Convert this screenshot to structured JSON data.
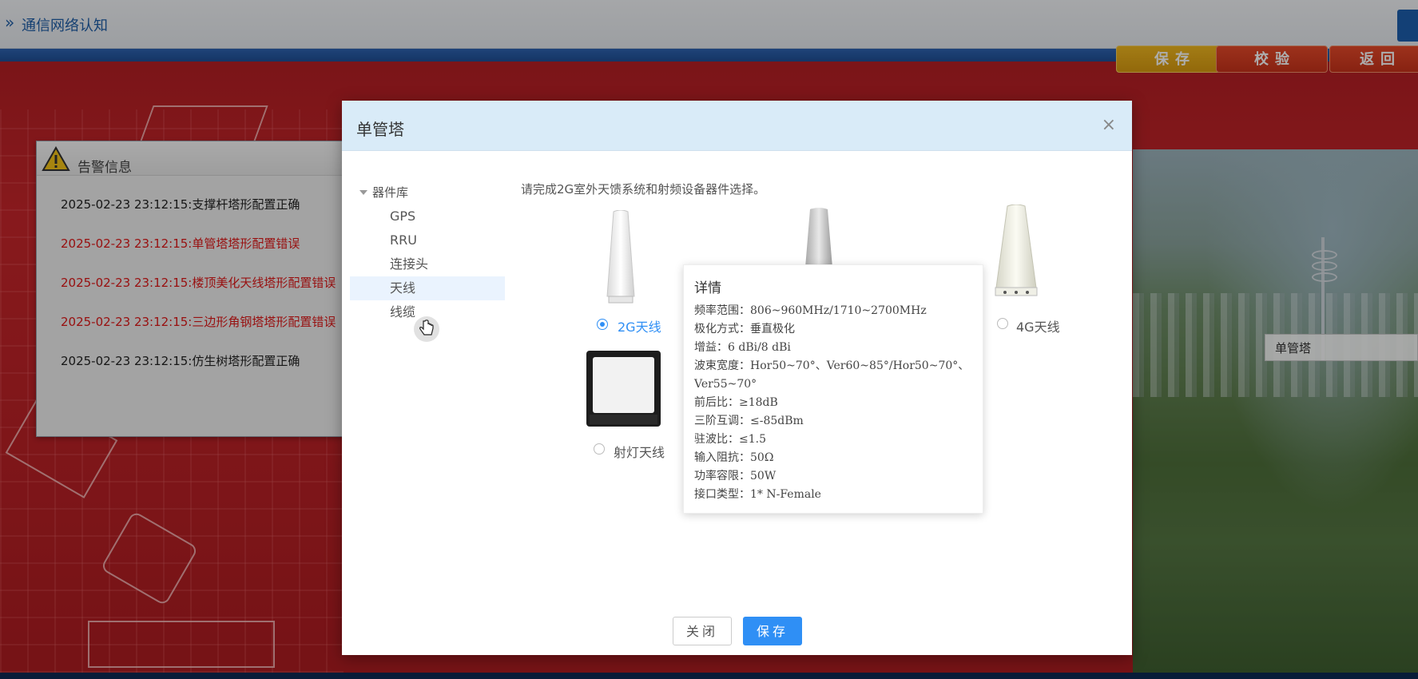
{
  "app": {
    "title": "通信网络认知"
  },
  "actions": {
    "save": "保存",
    "check": "校验",
    "back": "返回"
  },
  "tower_label": "单管塔",
  "alert": {
    "title": "告警信息",
    "lines": [
      {
        "text": "2025-02-23 23:12:15:支撑杆塔形配置正确",
        "status": "ok"
      },
      {
        "text": "2025-02-23 23:12:15:单管塔塔形配置错误",
        "status": "error"
      },
      {
        "text": "2025-02-23 23:12:15:楼顶美化天线塔形配置错误",
        "status": "error"
      },
      {
        "text": "2025-02-23 23:12:15:三边形角钢塔塔形配置错误",
        "status": "error"
      },
      {
        "text": "2025-02-23 23:12:15:仿生树塔形配置正确",
        "status": "ok"
      }
    ]
  },
  "modal": {
    "title": "单管塔",
    "close_symbol": "×",
    "prompt": "请完成2G室外天馈系统和射频设备器件选择。",
    "tree": {
      "root": "器件库",
      "items": [
        "GPS",
        "RRU",
        "连接头",
        "天线",
        "线缆"
      ],
      "active": "天线"
    },
    "options": {
      "antenna_2g": {
        "label": "2G天线",
        "checked": true
      },
      "antenna_4g": {
        "label": "4G天线",
        "checked": false
      },
      "spot_antenna": {
        "label": "射灯天线",
        "checked": false
      }
    },
    "detail": {
      "title": "详情",
      "rows": [
        "频率范围：806~960MHz/1710~2700MHz",
        "极化方式：垂直极化",
        "增益：6 dBi/8 dBi",
        "波束宽度：Hor50~70°、Ver60~85°/Hor50~70°、Ver55~70°",
        "前后比：≥18dB",
        "三阶互调：≤-85dBm",
        "驻波比：≤1.5",
        "输入阻抗：50Ω",
        "功率容限：50W",
        "接口类型：1* N-Female"
      ]
    },
    "footer": {
      "close": "关闭",
      "save": "保存"
    }
  },
  "colors": {
    "accent": "#2f8ff5",
    "error": "#e01818",
    "header_bg": "#d9ebf8"
  }
}
